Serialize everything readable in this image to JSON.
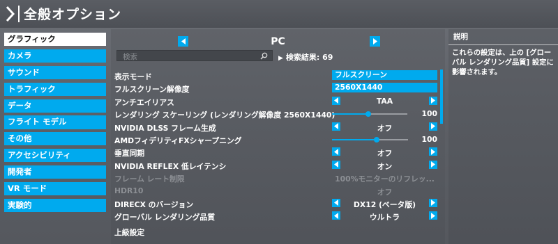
{
  "header": {
    "title": "全般オプション",
    "icon": "chevron-right-icon"
  },
  "sidebar": {
    "items": [
      {
        "label": "グラフィック",
        "active": true
      },
      {
        "label": "カメラ"
      },
      {
        "label": "サウンド"
      },
      {
        "label": "トラフィック"
      },
      {
        "label": "データ"
      },
      {
        "label": "フライト モデル"
      },
      {
        "label": "その他"
      },
      {
        "label": "アクセシビリティ"
      },
      {
        "label": "開発者"
      },
      {
        "label": "VR モード"
      },
      {
        "label": "実験的"
      }
    ]
  },
  "panel": {
    "profile": "PC",
    "search": {
      "placeholder": "検索",
      "value": ""
    },
    "results_label": "検索結果: 69",
    "settings": [
      {
        "label": "表示モード",
        "value": "フルスクリーン",
        "type": "field"
      },
      {
        "label": "フルスクリーン解像度",
        "value": "2560X1440",
        "type": "field"
      },
      {
        "label": "アンチエイリアス",
        "value": "TAA",
        "type": "select"
      },
      {
        "label": "レンダリング スケーリング (レンダリング解像度 2560X1440)",
        "value": "100",
        "type": "slider",
        "level": 0.5
      },
      {
        "label": "NVIDIA DLSS フレーム生成",
        "value": "オフ",
        "type": "select"
      },
      {
        "label": "AMDフィデリティFXシャープニング",
        "value": "100",
        "type": "slider",
        "level": 0.5
      },
      {
        "label": "垂直同期",
        "value": "オフ",
        "type": "select"
      },
      {
        "label": "NVIDIA REFLEX 低レイテンシ",
        "value": "オン",
        "type": "select"
      },
      {
        "label": "フレーム レート制限",
        "value": "100%モニターのリフレッ...",
        "type": "disabled"
      },
      {
        "label": "HDR10",
        "value": "オフ",
        "type": "disabled"
      },
      {
        "label": "DIRECX のバージョン",
        "value": "DX12 (ベータ版)",
        "type": "select"
      },
      {
        "label": "グローバル レンダリング品質",
        "value": "ウルトラ",
        "type": "select"
      }
    ],
    "section_heading": "上級設定"
  },
  "description": {
    "title": "説明",
    "body": "これらの設定は、上の [グローバル レンダリング品質] 設定に影響されます。"
  },
  "colors": {
    "accent": "#00aaee"
  }
}
